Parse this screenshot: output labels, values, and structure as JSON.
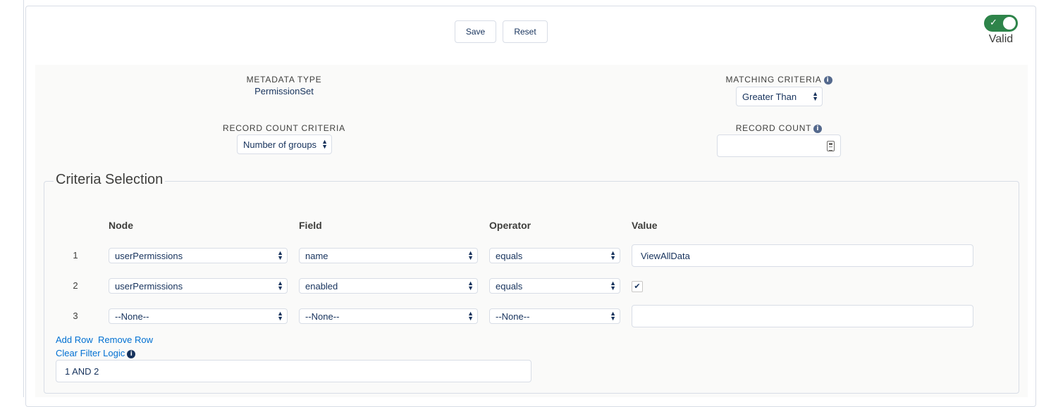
{
  "toolbar": {
    "save_label": "Save",
    "reset_label": "Reset"
  },
  "status": {
    "valid_label": "Valid",
    "toggle_on": true
  },
  "metadata": {
    "type_label": "METADATA TYPE",
    "type_value": "PermissionSet",
    "matching_label": "MATCHING CRITERIA",
    "matching_value": "Greater Than",
    "record_count_criteria_label": "RECORD COUNT CRITERIA",
    "record_count_criteria_value": "Number of groups",
    "record_count_label": "RECORD COUNT",
    "record_count_value": ""
  },
  "criteria": {
    "legend": "Criteria Selection",
    "headers": {
      "node": "Node",
      "field": "Field",
      "operator": "Operator",
      "value": "Value"
    },
    "rows": [
      {
        "num": "1",
        "node": "userPermissions",
        "field": "name",
        "operator": "equals",
        "value": "ViewAllData",
        "value_type": "text"
      },
      {
        "num": "2",
        "node": "userPermissions",
        "field": "enabled",
        "operator": "equals",
        "value": "✔",
        "value_type": "checkbox"
      },
      {
        "num": "3",
        "node": "--None--",
        "field": "--None--",
        "operator": "--None--",
        "value": "",
        "value_type": "text"
      }
    ],
    "add_row_label": "Add Row",
    "remove_row_label": "Remove Row",
    "clear_filter_label": "Clear Filter Logic",
    "filter_logic_value": "1 AND 2"
  },
  "colors": {
    "accent": "#0070d2",
    "toggle": "#2e844a",
    "text": "#16325c"
  }
}
